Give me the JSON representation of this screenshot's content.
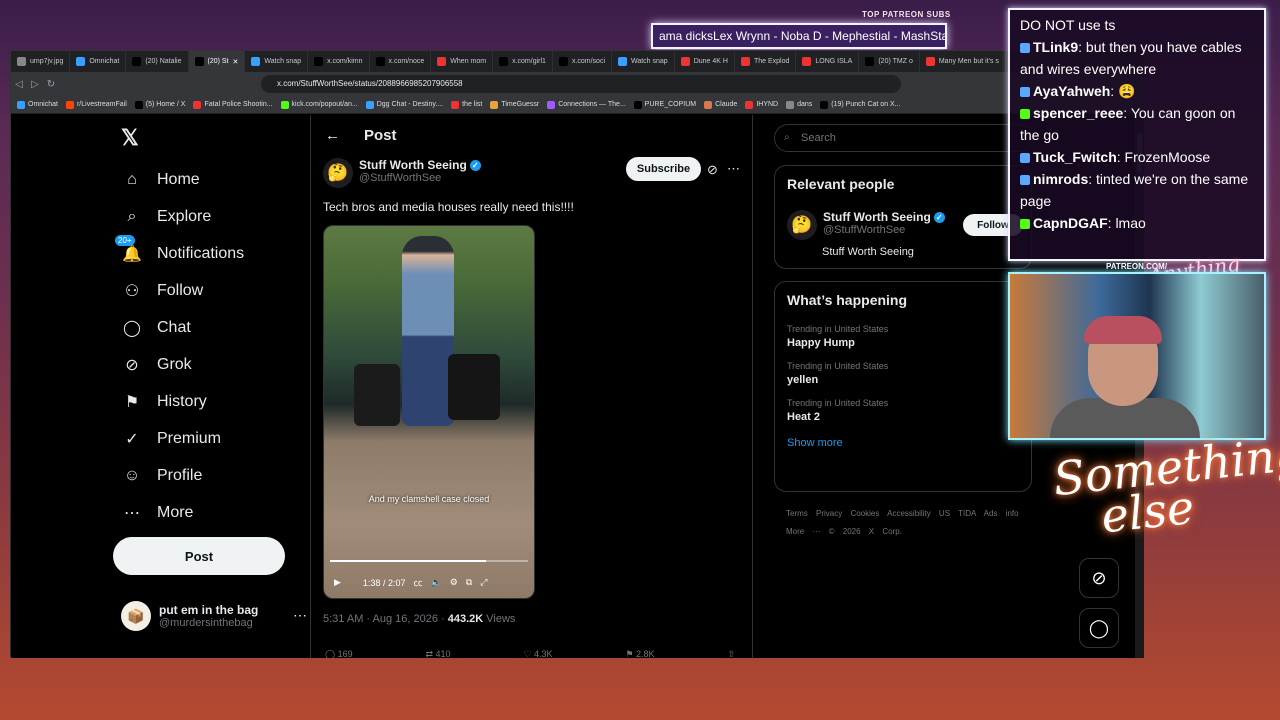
{
  "overlay": {
    "patreon_title": "TOP PATREON SUBS",
    "ticker": "ama dicksLex Wrynn - Noba D - Mephestial - MashStars",
    "patreon_url": "PATREON.COM/",
    "signature": "Anything else",
    "logo_line1": "Something",
    "logo_line2": "else"
  },
  "chat": [
    {
      "user": "",
      "text": "DO NOT use ts",
      "badge_color": ""
    },
    {
      "user": "TLink9",
      "text": ": but then you have cables and wires everywhere",
      "badge_color": "#5aa9ff"
    },
    {
      "user": "AyaYahweh",
      "text": ": 😩",
      "badge_color": "#5aa9ff"
    },
    {
      "user": "spencer_reee",
      "text": ": You can goon on the go",
      "badge_color": "#53fc18"
    },
    {
      "user": "Tuck_Fwitch",
      "text": ": FrozenMoose",
      "badge_color": "#5aa9ff"
    },
    {
      "user": "nimrods",
      "text": ": tinted we're on the same page",
      "badge_color": "#5aa9ff"
    },
    {
      "user": "CapnDGAF",
      "text": ": lmao",
      "badge_color": "#53fc18"
    }
  ],
  "browser": {
    "tabs": [
      {
        "label": "ump7jv.jpg",
        "active": false,
        "color": "#888"
      },
      {
        "label": "Omnichat",
        "active": false,
        "color": "#3aa0ff"
      },
      {
        "label": "(20) Natalie",
        "active": false,
        "color": "#000"
      },
      {
        "label": "(20) St",
        "active": true,
        "color": "#000"
      },
      {
        "label": "Watch snap",
        "active": false,
        "color": "#3aa0ff"
      },
      {
        "label": "x.com/kimn",
        "active": false,
        "color": "#000"
      },
      {
        "label": "x.com/noce",
        "active": false,
        "color": "#000"
      },
      {
        "label": "When mom",
        "active": false,
        "color": "#e33"
      },
      {
        "label": "x.com/girl1",
        "active": false,
        "color": "#000"
      },
      {
        "label": "x.com/soci",
        "active": false,
        "color": "#000"
      },
      {
        "label": "Watch snap",
        "active": false,
        "color": "#3aa0ff"
      },
      {
        "label": "Dune 4K H",
        "active": false,
        "color": "#e33"
      },
      {
        "label": "The Explod",
        "active": false,
        "color": "#e33"
      },
      {
        "label": "LONG ISLA",
        "active": false,
        "color": "#e33"
      },
      {
        "label": "(20) TMZ o",
        "active": false,
        "color": "#000"
      },
      {
        "label": "Many Men but it's s",
        "active": false,
        "color": "#e33"
      }
    ],
    "url": "x.com/StuffWorthSee/status/2088966985207906558",
    "bookmarks": [
      {
        "label": "Omnichat",
        "color": "#3aa0ff"
      },
      {
        "label": "r/LivestreamFail",
        "color": "#ff4500"
      },
      {
        "label": "(5) Home / X",
        "color": "#000"
      },
      {
        "label": "Fatal Police Shootin...",
        "color": "#e33"
      },
      {
        "label": "kick.com/popout/an...",
        "color": "#53fc18"
      },
      {
        "label": "Dgg Chat - Destiny....",
        "color": "#3aa0ff"
      },
      {
        "label": "the list",
        "color": "#e33"
      },
      {
        "label": "TimeGuessr",
        "color": "#e8a33a"
      },
      {
        "label": "Connections — The...",
        "color": "#a05aff"
      },
      {
        "label": "PURE_COPIUM",
        "color": "#000"
      },
      {
        "label": "Claude",
        "color": "#d9764a"
      },
      {
        "label": "IHYND",
        "color": "#e33"
      },
      {
        "label": "dans",
        "color": "#888"
      },
      {
        "label": "(19) Punch Cat on X...",
        "color": "#000"
      }
    ]
  },
  "x": {
    "nav": [
      {
        "icon": "⌂",
        "label": "Home",
        "name": "home"
      },
      {
        "icon": "⌕",
        "label": "Explore",
        "name": "explore"
      },
      {
        "icon": "🔔",
        "label": "Notifications",
        "name": "notifications",
        "badge": "20+"
      },
      {
        "icon": "⚇",
        "label": "Follow",
        "name": "follow"
      },
      {
        "icon": "◯",
        "label": "Chat",
        "name": "chat"
      },
      {
        "icon": "⊘",
        "label": "Grok",
        "name": "grok"
      },
      {
        "icon": "⚑",
        "label": "History",
        "name": "history"
      },
      {
        "icon": "✓",
        "label": "Premium",
        "name": "premium"
      },
      {
        "icon": "☺",
        "label": "Profile",
        "name": "profile"
      },
      {
        "icon": "⋯",
        "label": "More",
        "name": "more"
      }
    ],
    "post_button": "Post",
    "account": {
      "name": "put em in the bag",
      "handle": "@murdersinthebag"
    },
    "header": "Post",
    "tweet": {
      "author": "Stuff Worth Seeing",
      "handle": "@StuffWorthSee",
      "subscribe": "Subscribe",
      "text": "Tech bros and media houses really need this!!!!",
      "caption": "And my clamshell case closed",
      "time": "1:38 / 2:07",
      "progress": 0.79,
      "timestamp": "5:31 AM · Aug 16, 2026 · ",
      "views_count": "443.2K",
      "views_label": " Views",
      "actions": [
        "169",
        "410",
        "4.3K",
        "2.8K",
        ""
      ]
    },
    "search_placeholder": "Search",
    "relevant": {
      "title": "Relevant people",
      "name": "Stuff Worth Seeing",
      "handle": "@StuffWorthSee",
      "follow": "Follow",
      "desc": "Stuff Worth Seeing"
    },
    "happening": {
      "title": "What’s happening",
      "trends": [
        {
          "context": "Trending in United States",
          "name": "Happy Hump"
        },
        {
          "context": "Trending in United States",
          "name": "yellen"
        },
        {
          "context": "Trending in United States",
          "name": "Heat 2"
        }
      ],
      "show_more": "Show more"
    },
    "footer": "Terms Privacy Cookies Accessibility US TIDA Ads info More ··· © 2026 X Corp."
  }
}
